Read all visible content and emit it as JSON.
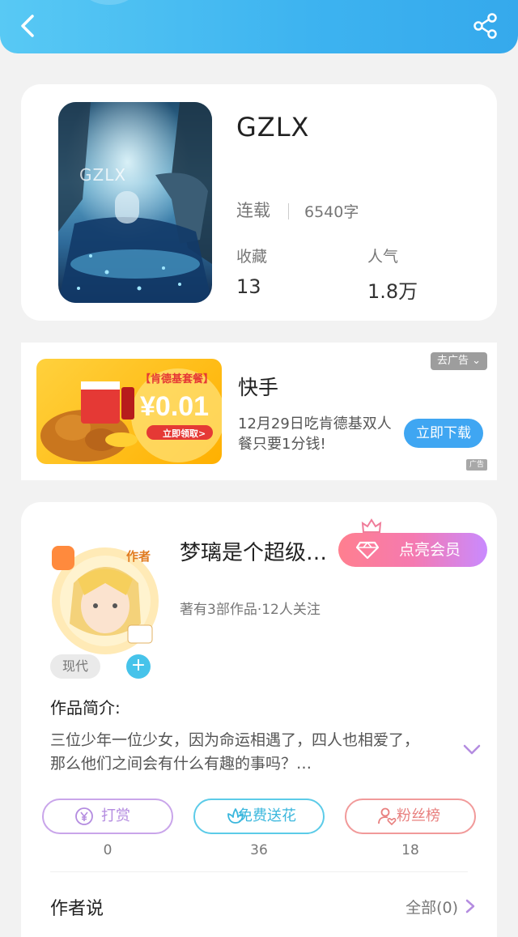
{
  "header": {
    "back_icon": "chevron-left-icon",
    "share_icon": "share-icon",
    "bg_color": "#3db3f0"
  },
  "book": {
    "cover_text": "GZLX",
    "title": "GZLX",
    "status": "连载",
    "word_count": "6540字",
    "stats": [
      {
        "label": "收藏",
        "value": "13"
      },
      {
        "label": "人气",
        "value": "1.8万"
      }
    ]
  },
  "ad": {
    "close_label": "去广告",
    "app_name": "快手",
    "description": "12月29日吃肯德基双人餐只要1分钱!",
    "button_label": "立即下载",
    "tag": "广告",
    "image_banner": "【肯德基套餐】",
    "image_price": "¥0.01",
    "image_cta": "立即领取>"
  },
  "author": {
    "badge": "作者",
    "name": "梦璃是个超级…",
    "vip_label": "点亮会员",
    "stats": "著有3部作品·12人关注",
    "genre": "现代",
    "add_label": "+"
  },
  "intro": {
    "title": "作品简介:",
    "text": "三位少年一位少女，因为命运相遇了，四人也相爱了，那么他们之间会有什么有趣的事吗？…"
  },
  "actions": [
    {
      "label": "打赏",
      "count": "0",
      "icon": "yen-coin-icon",
      "color": "#c49be8"
    },
    {
      "label": "免费送花",
      "count": "36",
      "icon": "flower-icon",
      "color": "#4ec7e8"
    },
    {
      "label": "粉丝榜",
      "count": "18",
      "icon": "user-heart-icon",
      "color": "#f08c8c"
    }
  ],
  "author_says": {
    "title": "作者说",
    "all_label": "全部(0)"
  }
}
